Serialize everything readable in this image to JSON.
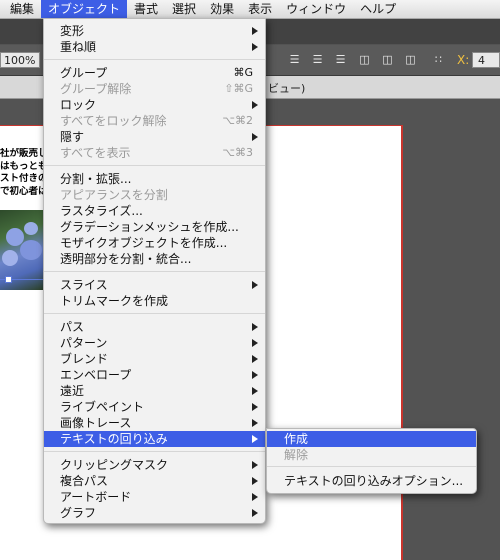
{
  "menubar": {
    "items": [
      {
        "label": "編集"
      },
      {
        "label": "オブジェクト"
      },
      {
        "label": "書式"
      },
      {
        "label": "選択"
      },
      {
        "label": "効果"
      },
      {
        "label": "表示"
      },
      {
        "label": "ウィンドウ"
      },
      {
        "label": "ヘルプ"
      }
    ]
  },
  "toolbar": {
    "zoom": "100%",
    "x_label": "X:",
    "x_value": "4"
  },
  "document": {
    "tab_fragment": "ビュー)",
    "text_lines": [
      "社が販売し",
      "はもっとも",
      "スト付きの",
      "で初心者は"
    ]
  },
  "object_menu": {
    "items": [
      {
        "label": "変形",
        "submenu": true,
        "disabled": false
      },
      {
        "label": "重ね順",
        "submenu": true,
        "disabled": false
      },
      {
        "label": "グループ",
        "shortcut": "⌘G",
        "disabled": false
      },
      {
        "label": "グループ解除",
        "shortcut": "⇧⌘G",
        "disabled": true
      },
      {
        "label": "ロック",
        "submenu": true,
        "disabled": false
      },
      {
        "label": "すべてをロック解除",
        "shortcut": "⌥⌘2",
        "disabled": true
      },
      {
        "label": "隠す",
        "submenu": true,
        "disabled": false
      },
      {
        "label": "すべてを表示",
        "shortcut": "⌥⌘3",
        "disabled": true
      },
      {
        "label": "分割・拡張...",
        "disabled": false
      },
      {
        "label": "アピアランスを分割",
        "disabled": true
      },
      {
        "label": "ラスタライズ...",
        "disabled": false
      },
      {
        "label": "グラデーションメッシュを作成...",
        "disabled": false
      },
      {
        "label": "モザイクオブジェクトを作成...",
        "disabled": false
      },
      {
        "label": "透明部分を分割・統合...",
        "disabled": false
      },
      {
        "label": "スライス",
        "submenu": true,
        "disabled": false
      },
      {
        "label": "トリムマークを作成",
        "disabled": false
      },
      {
        "label": "パス",
        "submenu": true,
        "disabled": false
      },
      {
        "label": "パターン",
        "submenu": true,
        "disabled": false
      },
      {
        "label": "ブレンド",
        "submenu": true,
        "disabled": false
      },
      {
        "label": "エンベロープ",
        "submenu": true,
        "disabled": false
      },
      {
        "label": "遠近",
        "submenu": true,
        "disabled": false
      },
      {
        "label": "ライブペイント",
        "submenu": true,
        "disabled": false
      },
      {
        "label": "画像トレース",
        "submenu": true,
        "disabled": false
      },
      {
        "label": "テキストの回り込み",
        "submenu": true,
        "disabled": false,
        "highlighted": true
      },
      {
        "label": "クリッピングマスク",
        "submenu": true,
        "disabled": false
      },
      {
        "label": "複合パス",
        "submenu": true,
        "disabled": false
      },
      {
        "label": "アートボード",
        "submenu": true,
        "disabled": false
      },
      {
        "label": "グラフ",
        "submenu": true,
        "disabled": false
      }
    ]
  },
  "text_wrap_submenu": {
    "items": [
      {
        "label": "作成",
        "highlighted": true
      },
      {
        "label": "解除",
        "disabled": true
      },
      {
        "label": "テキストの回り込みオプション..."
      }
    ]
  },
  "colors": {
    "accent": "#3d5ee6",
    "artboard_border": "#c8352e"
  }
}
